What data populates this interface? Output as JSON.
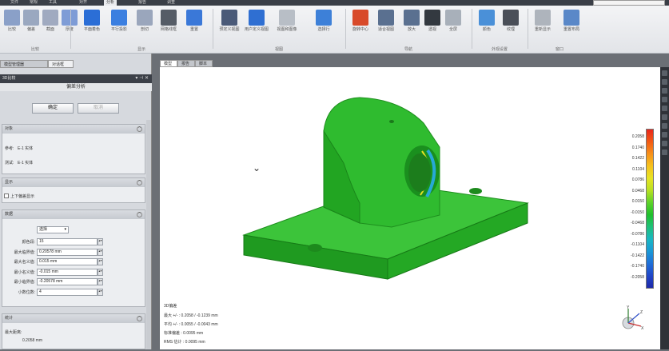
{
  "menu": {
    "tabs": [
      "文件",
      "常规",
      "工具",
      "对齐",
      "分析",
      "报告",
      "调查"
    ],
    "active_tab": 4
  },
  "ribbon": {
    "buttons": [
      {
        "label": "比较",
        "icon": "compare-icon",
        "color": "#8aa0c8"
      },
      {
        "label": "偏差",
        "icon": "deviation-icon",
        "color": "#9aa8c0"
      },
      {
        "label": "截面",
        "icon": "section-icon",
        "color": "#a0aac0"
      },
      {
        "label": "厚度",
        "icon": "thickness-icon",
        "color": "#7e9cd6"
      },
      {
        "label": "平面着色",
        "icon": "plane-color-icon",
        "color": "#2b6ed6"
      },
      {
        "label": "平行投影",
        "icon": "parallel-projection-icon",
        "color": "#3b7fe0"
      },
      {
        "label": "剖切",
        "icon": "cut-icon",
        "color": "#9aa6bc"
      },
      {
        "label": "网格线框",
        "icon": "grid-icon",
        "color": "#555c66"
      },
      {
        "label": "重置",
        "icon": "reset-icon",
        "color": "#3a78d8"
      },
      {
        "label": "预定义视图",
        "icon": "cube-view-icon",
        "color": "#4a5a78"
      },
      {
        "label": "用户定义视图",
        "icon": "user-view-icon",
        "color": "#2f6fd2"
      },
      {
        "label": "视图和图像",
        "icon": "image-icon",
        "color": "#b8bec6"
      },
      {
        "label": "选择行",
        "icon": "pen-icon",
        "color": "#3d80d8"
      },
      {
        "label": "旋转中心",
        "icon": "rotate-center-icon",
        "color": "#d84a2a"
      },
      {
        "label": "适合视图",
        "icon": "zoom-fit-icon",
        "color": "#5a7090"
      },
      {
        "label": "放大",
        "icon": "zoom-in-icon",
        "color": "#5a7090"
      },
      {
        "label": "透视",
        "icon": "perspective-icon",
        "color": "#333940"
      },
      {
        "label": "全屏",
        "icon": "fullscreen-icon",
        "color": "#a8b0ba"
      },
      {
        "label": "颜色",
        "icon": "color-dots-icon",
        "color": "#4a90d8"
      },
      {
        "label": "纹理",
        "icon": "hatch-icon",
        "color": "#4a4f58"
      },
      {
        "label": "重新显示",
        "icon": "redisplay-icon",
        "color": "#aeb4bc"
      },
      {
        "label": "重置布局",
        "icon": "reset-layout-icon",
        "color": "#5a88c8"
      }
    ],
    "groups": [
      "比较",
      "显示",
      "视图",
      "导航",
      "外观设置",
      "窗口"
    ]
  },
  "panel": {
    "tabs": [
      "模型管理器",
      "对话框"
    ],
    "title": "3D比较",
    "header": "偏差分析",
    "ok_label": "确定",
    "cancel_label": "取消",
    "object_section": {
      "title": "对象",
      "ref_label": "参考:",
      "ref_value": "E-1 实体",
      "test_label": "测试:",
      "test_value": "E-1 实体"
    },
    "display_section": {
      "title": "显示",
      "checkbox_label": "上下偏差显示"
    },
    "data_section": {
      "title": "数据",
      "mode_value": "选择",
      "fields": [
        {
          "label": "颜色段:",
          "value": "15"
        },
        {
          "label": "最大临界值:",
          "value": "0.20578 mm"
        },
        {
          "label": "最大名义值:",
          "value": "0.015 mm"
        },
        {
          "label": "最小名义值:",
          "value": "-0.015 mm"
        },
        {
          "label": "最小临界值:",
          "value": "-0.20578 mm"
        },
        {
          "label": "小数位数:",
          "value": "4"
        }
      ]
    },
    "stats_section": {
      "title": "统计",
      "max_label": "最大距离:",
      "max_value": "0.2058 mm"
    }
  },
  "viewport": {
    "tabs": [
      "模型",
      "报告",
      "脚本"
    ],
    "active_tab": 0,
    "stats": {
      "title": "3D偏差",
      "lines": [
        "最大 +/- : 0.2058 / -0.1239 mm",
        "平均 +/- : 0.0055 / -0.0043 mm",
        "标准偏差 : 0.0095 mm",
        "RMS 估计 : 0.0095 mm"
      ]
    },
    "legend": {
      "values": [
        "0.2058",
        "0.1740",
        "0.1422",
        "0.1104",
        "0.0786",
        "0.0468",
        "0.0150",
        "-0.0150",
        "-0.0468",
        "-0.0786",
        "-0.1104",
        "-0.1422",
        "-0.1740",
        "-0.2058"
      ],
      "colors": [
        "#e8261c",
        "#f25a14",
        "#f7911a",
        "#f6c21c",
        "#e7e423",
        "#b8e023",
        "#5ed22a",
        "#1fbf2c",
        "#1fc07a",
        "#19b7c2",
        "#1a98d6",
        "#1f6fd8",
        "#2046c8",
        "#1f2aa8"
      ]
    },
    "model_color": "#28b12a",
    "triad": {
      "x": "X",
      "y": "Y",
      "z": "Z"
    }
  }
}
